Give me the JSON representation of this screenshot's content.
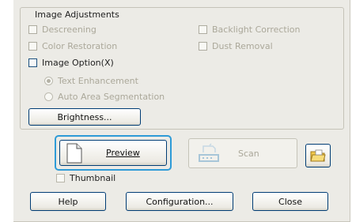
{
  "group": {
    "title": "Image Adjustments",
    "descreening": "Descreening",
    "backlight_correction": "Backlight Correction",
    "color_restoration": "Color Restoration",
    "dust_removal": "Dust Removal",
    "image_option": "Image Option(X)",
    "text_enhancement": "Text Enhancement",
    "auto_area_segmentation": "Auto Area Segmentation",
    "brightness_button": "Brightness..."
  },
  "actions": {
    "preview": "Preview",
    "scan": "Scan",
    "thumbnail": "Thumbnail"
  },
  "footer": {
    "help": "Help",
    "configuration": "Configuration...",
    "close": "Close"
  },
  "icons": {
    "preview": "document-page-icon",
    "scan": "scanner-icon",
    "folder": "folder-icon"
  },
  "colors": {
    "window_bg": "#ecebe6",
    "button_border": "#003c74",
    "focus_ring": "#2e9bd7",
    "disabled_text": "#aba89a"
  }
}
